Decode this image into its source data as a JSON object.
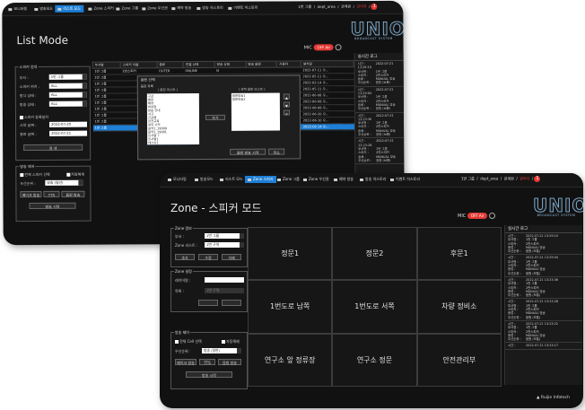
{
  "common": {
    "nav": [
      "모니터링",
      "방송모드",
      "리스트 모드",
      "Zone 스피커",
      "Zone 그룹",
      "Zone 우선권",
      "예약 방송",
      "방송 히스토리",
      "이벤트 히스토리"
    ],
    "user": "1번 그룹",
    "user_id": "dept_area",
    "role": "관계원",
    "admin": "관리자",
    "alert_count": "1",
    "logo_word": "UNION",
    "logo_sub": "BROADCAST SYSTEM",
    "mic_label": "MIC",
    "mic_status": "OFF Air"
  },
  "back": {
    "title": "List Mode",
    "active_nav": "리스트 모드",
    "search": {
      "title": "스피커 검색",
      "fields": [
        {
          "label": "부서 :",
          "value": "1번 그룹"
        },
        {
          "label": "스피커 위치 :",
          "value": "ALL"
        },
        {
          "label": "방식 상태 :",
          "value": "ALL"
        },
        {
          "label": "방송 상태 :",
          "value": "ALL"
        }
      ],
      "check_label": "스피커 등록일자",
      "start_label": "시작 날짜 :",
      "start_value": "2022-07-20",
      "end_label": "종료 날짜 :",
      "end_value": "2022-07-21",
      "button": "검 색"
    },
    "broadcast": {
      "title": "방송 제어",
      "all_select": "전체 스피커 선택",
      "select_label": "자동해제",
      "priority_label": "우선순위 :",
      "priority_value": "방송 (일반)",
      "buttons": [
        "메이크 방송",
        "TTS",
        "음원 방송"
      ],
      "start": "방송 시작"
    },
    "table": {
      "headers": [
        "부서명",
        "스피커 이름",
        "종류",
        "연결 상태",
        "방송 상태",
        "방송 음원",
        "사용자",
        "설치일"
      ],
      "rows": [
        [
          "1번 그룹",
          "2번스피커",
          "OUTER",
          "ONLINE",
          "N",
          "",
          "",
          "2022-07-11 오..."
        ],
        [
          "1번 그룹",
          "",
          "",
          "",
          "",
          "",
          "",
          "2022-05-11 오..."
        ],
        [
          "1번 그룹",
          "",
          "",
          "",
          "",
          "",
          "",
          "2022-02-14 오..."
        ],
        [
          "1번 그룹",
          "",
          "",
          "",
          "",
          "",
          "",
          "2022-05-11 오..."
        ],
        [
          "1번 그룹",
          "",
          "",
          "",
          "",
          "",
          "",
          "2022-06-08 오..."
        ],
        [
          "1번 그룹",
          "",
          "",
          "",
          "",
          "",
          "",
          "2022-06-08 오..."
        ],
        [
          "1번 그룹",
          "",
          "",
          "",
          "",
          "",
          "",
          "2022-06-08 오..."
        ],
        [
          "1번 그룹",
          "",
          "",
          "",
          "",
          "",
          "",
          "2022-06-20 오..."
        ],
        [
          "1번 그룹",
          "",
          "",
          "",
          "",
          "",
          "",
          "2022-06-10 오..."
        ],
        [
          "1번 그룹",
          "",
          "",
          "",
          "",
          "",
          "",
          "2022-02-14 오..."
        ]
      ]
    },
    "dialog": {
      "title": "음원 선택",
      "subtitle": "음원 목록",
      "left_header": "( 음원 리스트 )",
      "right_header": "( 선택 음원 리스트 )",
      "left_items": [
        "구급",
        "법호",
        "해양",
        "버상참",
        "방송 안내",
        "사고",
        "긴급벨",
        "안전교육",
        "회의 시작",
        "음악1_19000",
        "음악1_19001",
        "인사말 7",
        "인사말1",
        "테스트1",
        "안내음성",
        "음원 재생 음원"
      ],
      "right_items": [
        "음원방송1",
        "음원방송2"
      ],
      "move_btn": "추가",
      "ok": "음원 방송 시작",
      "cancel": "취소"
    },
    "log_title": "실시간 로그",
    "logs": [
      {
        "time": "2022-07-21 13:29:10",
        "group": "1번 그룹",
        "speaker": "2번스피커",
        "user": "MANUAL 방송",
        "result": "음원 (보통)"
      },
      {
        "time": "2022-07-21 13:29:04",
        "group": "1번 그룹",
        "speaker": "2번스피커",
        "user": "MANUAL 방송",
        "result": "음원 (보통)"
      },
      {
        "time": "2022-07-21 13:23:36",
        "group": "1번 그룹",
        "speaker": "2번스피커",
        "user": "MANUAL 방송",
        "result": "음원 (보통)"
      },
      {
        "time": "2022-07-21 13:23:28",
        "group": "1번 그룹",
        "speaker": "2번스피커",
        "user": "MANUAL 방송",
        "result": "음원 (보통)"
      }
    ]
  },
  "front": {
    "title": "Zone - 스피커 모드",
    "active_nav": "Zone 스피커",
    "zone_info": {
      "title": "Zone 정보",
      "dept_label": "부서 :",
      "dept_value": "1번 그룹",
      "zone_label": "Zone 리스트 :",
      "zone_value": "1번 구역",
      "buttons": [
        "추가",
        "수정",
        "삭제"
      ]
    },
    "zone_settings": {
      "title": "Zone 설정",
      "name_label": "레이어명 :",
      "layer_label": "목록 :",
      "layer_value": "1번 구역"
    },
    "broadcast": {
      "title": "방송 제어",
      "all_select": "전체 Cell 선택",
      "select_label": "자동해제",
      "priority_label": "우선순위 :",
      "priority_value": "방송 (일반)",
      "buttons": [
        "메이크 방송",
        "TTS",
        "음원 방송"
      ],
      "start": "방송 시작"
    },
    "zones": [
      "정문1",
      "정문2",
      "후문1",
      "1번도로 남쪽",
      "1번도로 서쪽",
      "차량 정비소",
      "연구소 앞 정류장",
      "연구소 정문",
      "안전관리부"
    ],
    "log_title": "실시간 로그",
    "logs": [
      {
        "time": "2022-07-21 13:29:10",
        "group": "1번 그룹",
        "speaker": "2번스피커",
        "user": "MANUAL 방송",
        "result": "음원 (보통)"
      },
      {
        "time": "2022-07-21 13:29:04",
        "group": "1번 그룹",
        "speaker": "2번스피커",
        "user": "MANUAL 방송",
        "result": "음원 (보통)"
      },
      {
        "time": "2022-07-21 13:23:36",
        "group": "1번 그룹",
        "speaker": "2번스피커",
        "user": "MANUAL 방송",
        "result": "음원 (보통)"
      },
      {
        "time": "2022-07-21 13:23:28",
        "group": "1번 그룹",
        "speaker": "2번스피커",
        "user": "MANUAL 방송",
        "result": "음원 (보통)"
      },
      {
        "time": "2022-07-21 13:23:22",
        "group": "1번 그룹",
        "speaker": "2번스피커",
        "user": "MANUAL 방송",
        "result": "음원 (보통)"
      },
      {
        "time": "2022-07-21 13:23:17",
        "group": "",
        "speaker": "",
        "user": "",
        "result": ""
      }
    ],
    "brand": "Ruijie Infotech"
  },
  "log_labels": {
    "time": "시간 :",
    "group": "부서명 :",
    "speaker": "스피커 :",
    "user": "종류 :",
    "result": "우선순위 :"
  },
  "colors": {
    "accent": "#1d7fd6",
    "alert": "#e53935",
    "bg": "#111111"
  }
}
